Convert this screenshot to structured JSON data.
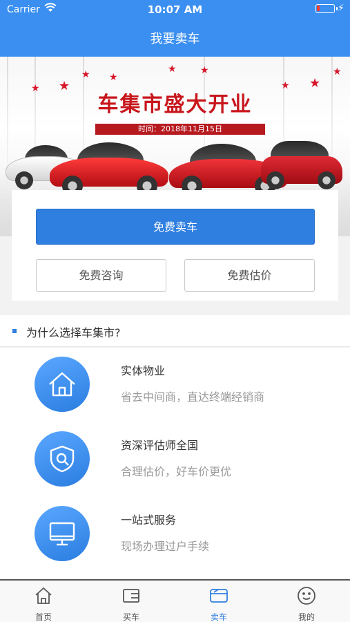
{
  "status_bar": {
    "carrier": "Carrier",
    "time": "10:07 AM"
  },
  "nav": {
    "title": "我要卖车"
  },
  "banner": {
    "headline": "车集市盛大开业",
    "date_text": "时间：2018年11月15日"
  },
  "actions": {
    "primary": "免费卖车",
    "consult": "免费咨询",
    "estimate": "免费估价"
  },
  "why": {
    "heading": "为什么选择车集市?",
    "items": [
      {
        "title": "实体物业",
        "desc": "省去中间商，直达终端经销商",
        "icon": "house-icon"
      },
      {
        "title": "资深评估师全国",
        "desc": "合理估价，好车价更优",
        "icon": "shield-search-icon"
      },
      {
        "title": "一站式服务",
        "desc": "现场办理过户手续",
        "icon": "monitor-icon"
      }
    ]
  },
  "tabs": [
    {
      "label": "首页",
      "icon": "home-icon",
      "active": false
    },
    {
      "label": "买车",
      "icon": "wallet-icon",
      "active": false
    },
    {
      "label": "卖车",
      "icon": "card-icon",
      "active": true
    },
    {
      "label": "我的",
      "icon": "smiley-icon",
      "active": false
    }
  ],
  "colors": {
    "accent": "#2f7fe0",
    "nav": "#3a8ff0",
    "banner_red": "#c8161d"
  }
}
